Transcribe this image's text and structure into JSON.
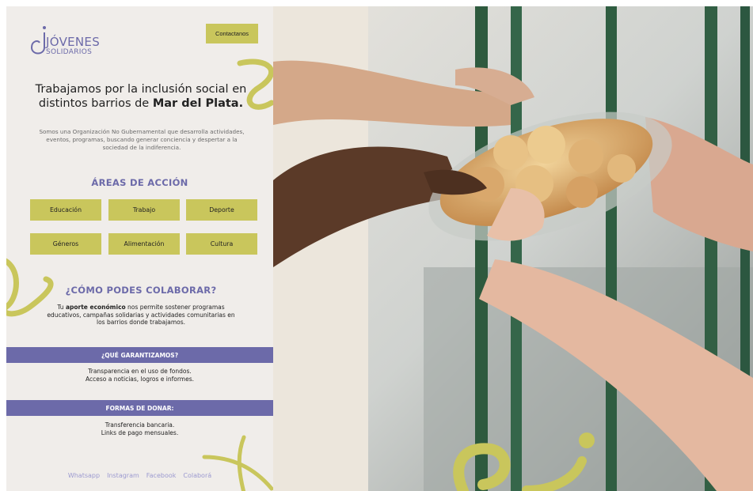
{
  "logo": {
    "line1": "JÓVENES",
    "line2": "SOLIDARIOS"
  },
  "header": {
    "contact_label": "Contactanos"
  },
  "hero": {
    "title_part1": "Trabajamos por la inclusión social en distintos barrios de ",
    "title_bold": "Mar del Plata."
  },
  "intro": "Somos una Organización No Gubernamental que desarrolla actividades, eventos, programas, buscando generar conciencia y despertar a la sociedad de la indiferencia.",
  "areas": {
    "title": "ÁREAS DE ACCIÓN",
    "items": [
      "Educación",
      "Trabajo",
      "Deporte",
      "Géneros",
      "Alimentación",
      "Cultura"
    ]
  },
  "collaborate": {
    "title": "¿CÓMO PODES COLABORAR?",
    "text_prefix": "Tu ",
    "text_bold": "aporte económico",
    "text_suffix": " nos permite sostener programas educativos, campañas solidarias y actividades comunitarias en los barrios donde trabajamos."
  },
  "guarantee": {
    "title": "¿QUÉ GARANTIZAMOS?",
    "line1": "Transparencia en el uso de fondos.",
    "line2": "Acceso a noticias, logros e informes."
  },
  "donate": {
    "title": "FORMAS DE DONAR:",
    "line1": "Transferencia bancaria.",
    "line2": "Links de pago mensuales."
  },
  "footer": {
    "links": [
      "Whatsapp",
      "Instagram",
      "Facebook",
      "Colaborá"
    ]
  },
  "colors": {
    "purple": "#6c6aa9",
    "olive": "#c9c65c",
    "panel": "#f0edea"
  }
}
